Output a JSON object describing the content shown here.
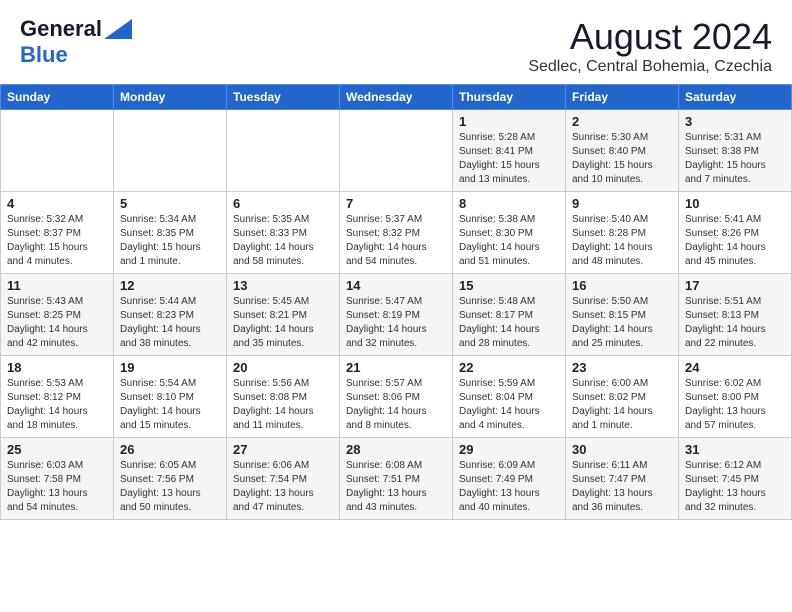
{
  "header": {
    "logo_general": "General",
    "logo_blue": "Blue",
    "main_title": "August 2024",
    "subtitle": "Sedlec, Central Bohemia, Czechia"
  },
  "calendar": {
    "days_of_week": [
      "Sunday",
      "Monday",
      "Tuesday",
      "Wednesday",
      "Thursday",
      "Friday",
      "Saturday"
    ],
    "weeks": [
      {
        "days": [
          {
            "num": "",
            "info": ""
          },
          {
            "num": "",
            "info": ""
          },
          {
            "num": "",
            "info": ""
          },
          {
            "num": "",
            "info": ""
          },
          {
            "num": "1",
            "info": "Sunrise: 5:28 AM\nSunset: 8:41 PM\nDaylight: 15 hours\nand 13 minutes."
          },
          {
            "num": "2",
            "info": "Sunrise: 5:30 AM\nSunset: 8:40 PM\nDaylight: 15 hours\nand 10 minutes."
          },
          {
            "num": "3",
            "info": "Sunrise: 5:31 AM\nSunset: 8:38 PM\nDaylight: 15 hours\nand 7 minutes."
          }
        ]
      },
      {
        "days": [
          {
            "num": "4",
            "info": "Sunrise: 5:32 AM\nSunset: 8:37 PM\nDaylight: 15 hours\nand 4 minutes."
          },
          {
            "num": "5",
            "info": "Sunrise: 5:34 AM\nSunset: 8:35 PM\nDaylight: 15 hours\nand 1 minute."
          },
          {
            "num": "6",
            "info": "Sunrise: 5:35 AM\nSunset: 8:33 PM\nDaylight: 14 hours\nand 58 minutes."
          },
          {
            "num": "7",
            "info": "Sunrise: 5:37 AM\nSunset: 8:32 PM\nDaylight: 14 hours\nand 54 minutes."
          },
          {
            "num": "8",
            "info": "Sunrise: 5:38 AM\nSunset: 8:30 PM\nDaylight: 14 hours\nand 51 minutes."
          },
          {
            "num": "9",
            "info": "Sunrise: 5:40 AM\nSunset: 8:28 PM\nDaylight: 14 hours\nand 48 minutes."
          },
          {
            "num": "10",
            "info": "Sunrise: 5:41 AM\nSunset: 8:26 PM\nDaylight: 14 hours\nand 45 minutes."
          }
        ]
      },
      {
        "days": [
          {
            "num": "11",
            "info": "Sunrise: 5:43 AM\nSunset: 8:25 PM\nDaylight: 14 hours\nand 42 minutes."
          },
          {
            "num": "12",
            "info": "Sunrise: 5:44 AM\nSunset: 8:23 PM\nDaylight: 14 hours\nand 38 minutes."
          },
          {
            "num": "13",
            "info": "Sunrise: 5:45 AM\nSunset: 8:21 PM\nDaylight: 14 hours\nand 35 minutes."
          },
          {
            "num": "14",
            "info": "Sunrise: 5:47 AM\nSunset: 8:19 PM\nDaylight: 14 hours\nand 32 minutes."
          },
          {
            "num": "15",
            "info": "Sunrise: 5:48 AM\nSunset: 8:17 PM\nDaylight: 14 hours\nand 28 minutes."
          },
          {
            "num": "16",
            "info": "Sunrise: 5:50 AM\nSunset: 8:15 PM\nDaylight: 14 hours\nand 25 minutes."
          },
          {
            "num": "17",
            "info": "Sunrise: 5:51 AM\nSunset: 8:13 PM\nDaylight: 14 hours\nand 22 minutes."
          }
        ]
      },
      {
        "days": [
          {
            "num": "18",
            "info": "Sunrise: 5:53 AM\nSunset: 8:12 PM\nDaylight: 14 hours\nand 18 minutes."
          },
          {
            "num": "19",
            "info": "Sunrise: 5:54 AM\nSunset: 8:10 PM\nDaylight: 14 hours\nand 15 minutes."
          },
          {
            "num": "20",
            "info": "Sunrise: 5:56 AM\nSunset: 8:08 PM\nDaylight: 14 hours\nand 11 minutes."
          },
          {
            "num": "21",
            "info": "Sunrise: 5:57 AM\nSunset: 8:06 PM\nDaylight: 14 hours\nand 8 minutes."
          },
          {
            "num": "22",
            "info": "Sunrise: 5:59 AM\nSunset: 8:04 PM\nDaylight: 14 hours\nand 4 minutes."
          },
          {
            "num": "23",
            "info": "Sunrise: 6:00 AM\nSunset: 8:02 PM\nDaylight: 14 hours\nand 1 minute."
          },
          {
            "num": "24",
            "info": "Sunrise: 6:02 AM\nSunset: 8:00 PM\nDaylight: 13 hours\nand 57 minutes."
          }
        ]
      },
      {
        "days": [
          {
            "num": "25",
            "info": "Sunrise: 6:03 AM\nSunset: 7:58 PM\nDaylight: 13 hours\nand 54 minutes."
          },
          {
            "num": "26",
            "info": "Sunrise: 6:05 AM\nSunset: 7:56 PM\nDaylight: 13 hours\nand 50 minutes."
          },
          {
            "num": "27",
            "info": "Sunrise: 6:06 AM\nSunset: 7:54 PM\nDaylight: 13 hours\nand 47 minutes."
          },
          {
            "num": "28",
            "info": "Sunrise: 6:08 AM\nSunset: 7:51 PM\nDaylight: 13 hours\nand 43 minutes."
          },
          {
            "num": "29",
            "info": "Sunrise: 6:09 AM\nSunset: 7:49 PM\nDaylight: 13 hours\nand 40 minutes."
          },
          {
            "num": "30",
            "info": "Sunrise: 6:11 AM\nSunset: 7:47 PM\nDaylight: 13 hours\nand 36 minutes."
          },
          {
            "num": "31",
            "info": "Sunrise: 6:12 AM\nSunset: 7:45 PM\nDaylight: 13 hours\nand 32 minutes."
          }
        ]
      }
    ]
  }
}
